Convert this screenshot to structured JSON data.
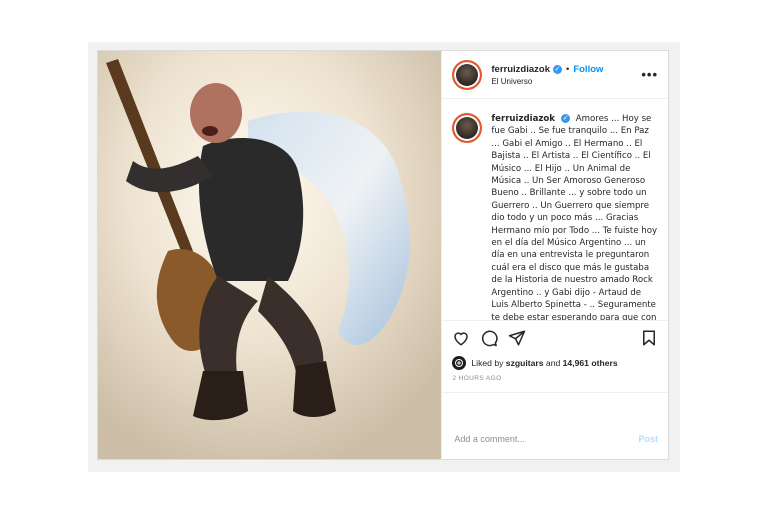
{
  "post": {
    "username": "ferruizdiazok",
    "follow_label": "Follow",
    "separator": "•",
    "location": "El Universo",
    "caption": "Amores ... Hoy se fue Gabi .. Se fue tranquilo ... En Paz ... Gabi el Amigo .. El Hermano .. El Bajista .. El Artista .. El Científico .. El Músico ... El Hijo .. Un Animal de Música .. Un Ser Amoroso Generoso Bueno .. Brillante ... y sobre todo un Guerrero .. Un Guerrero que siempre dio todo y un poco más ... Gracias Hermano mío por Todo ... Te fuiste hoy en el día del Músico Argentino ... un día en una entrevista le preguntaron cuál era el disco que más le gustaba de la Historia de nuestro amado Rock Argentino .. y Gabi dijo - Artaud de Luis Alberto Spinetta - .. Seguramente te debe estar esperando para que con tus Cuatro Cuerdas Mágicas hagas lo que más amaste en tu Maravillosa e Increíble Vida .. El Bajo y La Música ...",
    "liked_by_prefix": "Liked by",
    "liked_by_user": "szguitars",
    "liked_by_and": "and",
    "likes_count": "14,961 others",
    "timestamp": "2 HOURS AGO",
    "comment_placeholder": "Add a comment...",
    "post_button": "Post"
  },
  "icons": {
    "more": "more-options-icon",
    "like": "heart-icon",
    "comment": "comment-icon",
    "share": "paper-plane-icon",
    "save": "bookmark-icon",
    "verified": "verified-badge-icon"
  },
  "colors": {
    "follow": "#0095f6",
    "verified": "#3897f0",
    "post_disabled": "#b2dffc",
    "border": "#dbdbdb"
  }
}
